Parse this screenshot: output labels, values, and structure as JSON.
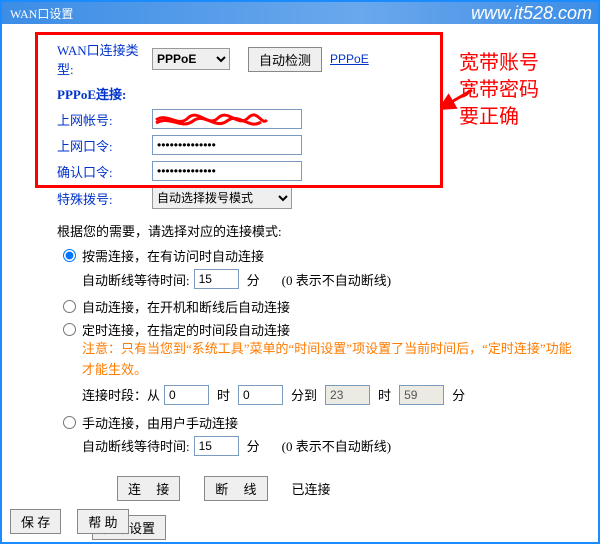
{
  "titlebar": {
    "title": "WAN口设置",
    "watermark": "www.it528.com"
  },
  "annotation": {
    "line1": "宽带账号",
    "line2": "宽带密码",
    "line3": "要正确"
  },
  "wan": {
    "type_label": "WAN口连接类型:",
    "type_value": "PPPoE",
    "auto_detect": "自动检测",
    "pppoe_link": "PPPoE"
  },
  "pppoe": {
    "section": "PPPoE连接:",
    "user_label": "上网帐号:",
    "user_value": "",
    "pass_label": "上网口令:",
    "pass_value": "••••••••••••••",
    "confirm_label": "确认口令:",
    "confirm_value": "••••••••••••••",
    "special_label": "特殊拨号:",
    "special_value": "自动选择拨号模式"
  },
  "mode": {
    "intro": "根据您的需要，请选择对应的连接模式:",
    "opt1": {
      "title": "按需连接，在有访问时自动连接",
      "idle_label": "自动断线等待时间:",
      "idle_value": "15",
      "idle_unit": "分",
      "idle_hint": "(0 表示不自动断线)"
    },
    "opt2": {
      "title": "自动连接，在开机和断线后自动连接"
    },
    "opt3": {
      "title": "定时连接，在指定的时间段自动连接",
      "note": "注意：只有当您到“系统工具”菜单的“时间设置”项设置了当前时间后，“定时连接”功能才能生效。",
      "range_label": "连接时段：从",
      "from_h": "0",
      "h_unit": "时",
      "from_m": "0",
      "m_unit": "分到",
      "to_h": "23",
      "to_m": "59",
      "m2_unit": "分"
    },
    "opt4": {
      "title": "手动连接，由用户手动连接",
      "idle_label": "自动断线等待时间:",
      "idle_value": "15",
      "idle_unit": "分",
      "idle_hint": "(0 表示不自动断线)"
    }
  },
  "actions": {
    "connect": "连 接",
    "disconnect": "断 线",
    "status": "已连接",
    "advanced": "高级设置",
    "save": "保 存",
    "help": "帮 助"
  }
}
